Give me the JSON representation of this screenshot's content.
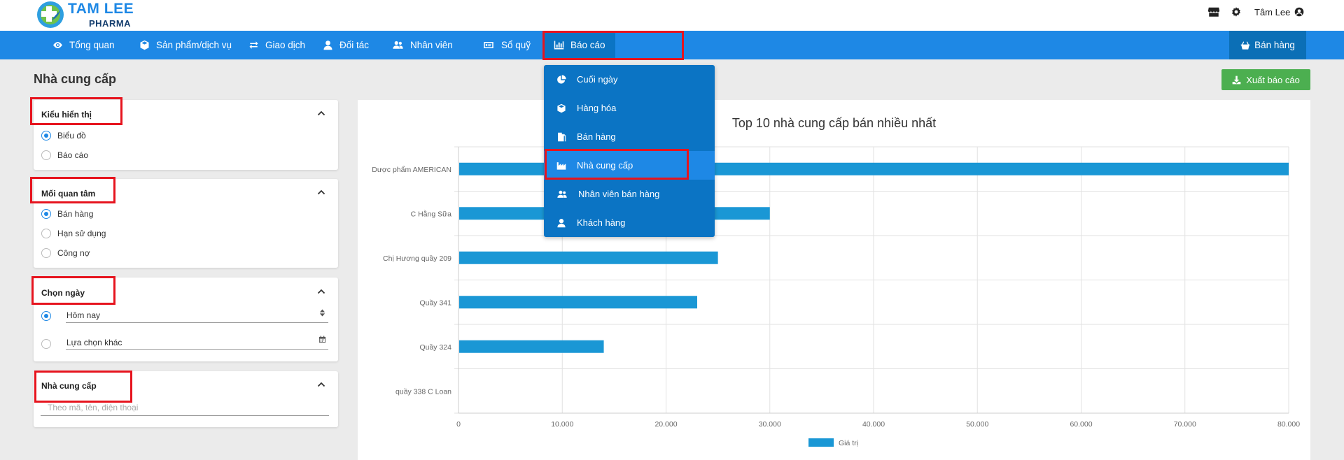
{
  "brand": {
    "name": "TAM LEE",
    "subtitle": "PHARMA"
  },
  "header": {
    "user_name": "Tâm Lee",
    "icons": [
      "store-icon",
      "gear-icon",
      "user-circle-icon"
    ]
  },
  "nav": {
    "items": [
      {
        "label": "Tổng quan",
        "icon": "eye-icon"
      },
      {
        "label": "Sản phẩm/dịch vụ",
        "icon": "box-icon"
      },
      {
        "label": "Giao dịch",
        "icon": "exchange-icon"
      },
      {
        "label": "Đối tác",
        "icon": "user-icon"
      },
      {
        "label": "Nhân viên",
        "icon": "users-icon"
      },
      {
        "label": "Sổ quỹ",
        "icon": "money-icon"
      },
      {
        "label": "Báo cáo",
        "icon": "bar-chart-icon",
        "active": true
      }
    ],
    "sell_button": "Bán hàng"
  },
  "report_menu": {
    "items": [
      {
        "label": "Cuối ngày",
        "icon": "pie-chart-icon"
      },
      {
        "label": "Hàng hóa",
        "icon": "box-icon"
      },
      {
        "label": "Bán hàng",
        "icon": "copy-icon"
      },
      {
        "label": "Nhà cung cấp",
        "icon": "industry-icon",
        "selected": true
      },
      {
        "label": "Nhân viên bán hàng",
        "icon": "users-icon"
      },
      {
        "label": "Khách hàng",
        "icon": "user-icon"
      }
    ]
  },
  "page": {
    "title": "Nhà cung cấp",
    "export_button": "Xuất báo cáo"
  },
  "filters": {
    "display_type": {
      "title": "Kiểu hiển thị",
      "options": [
        "Biểu đồ",
        "Báo cáo"
      ],
      "selected": "Biểu đồ"
    },
    "concern": {
      "title": "Mối quan tâm",
      "options": [
        "Bán hàng",
        "Hạn sử dụng",
        "Công nợ"
      ],
      "selected": "Bán hàng"
    },
    "date": {
      "title": "Chọn ngày",
      "preset_value": "Hôm nay",
      "custom_label": "Lựa chọn khác",
      "selected": "preset"
    },
    "supplier": {
      "title": "Nhà cung cấp",
      "placeholder": "Theo mã, tên, điện thoại"
    }
  },
  "chart_data": {
    "type": "bar",
    "orientation": "horizontal",
    "title": "Top 10 nhà cung cấp bán nhiều nhất",
    "categories": [
      "Dược phẩm AMERICAN",
      "C Hằng Sữa",
      "Chị Hương quầy 209",
      "Quầy 341",
      "Quầy 324",
      "quầy 338 C Loan"
    ],
    "series": [
      {
        "name": "Giá trị",
        "values": [
          80000,
          30000,
          25000,
          23000,
          14000,
          0
        ]
      }
    ],
    "x_ticks": [
      "0",
      "10.000",
      "20.000",
      "30.000",
      "40.000",
      "50.000",
      "60.000",
      "70.000",
      "80.000"
    ],
    "xlim": [
      0,
      80000
    ],
    "grid": true,
    "legend_position": "bottom",
    "bar_color": "#1a97d5"
  }
}
